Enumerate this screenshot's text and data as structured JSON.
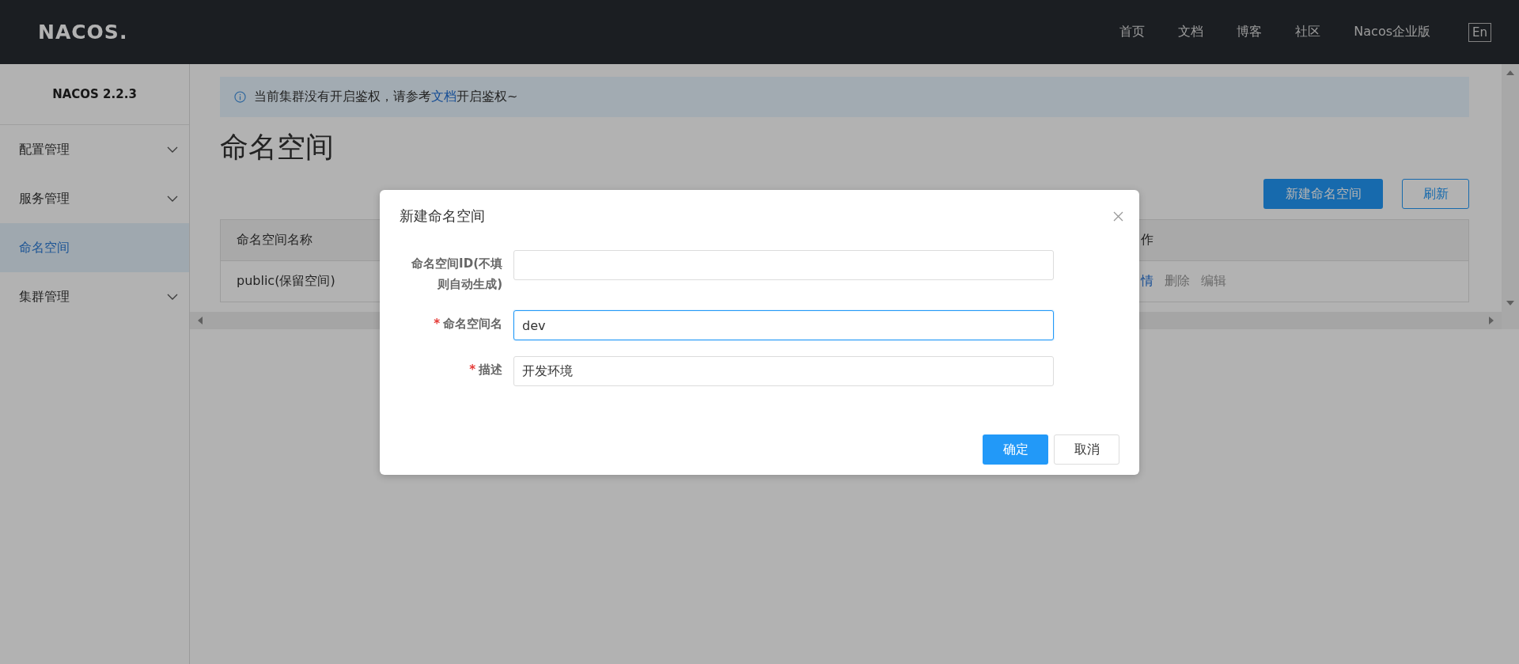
{
  "header": {
    "logo": "NACOS.",
    "nav": [
      {
        "label": "首页"
      },
      {
        "label": "文档"
      },
      {
        "label": "博客"
      },
      {
        "label": "社区"
      },
      {
        "label": "Nacos企业版"
      }
    ],
    "language": "En"
  },
  "sidebar": {
    "version": "NACOS 2.2.3",
    "items": [
      {
        "label": "配置管理",
        "selected": false,
        "expandable": true
      },
      {
        "label": "服务管理",
        "selected": false,
        "expandable": true
      },
      {
        "label": "命名空间",
        "selected": true,
        "expandable": false
      },
      {
        "label": "集群管理",
        "selected": false,
        "expandable": true
      }
    ]
  },
  "alert": {
    "text_before": "当前集群没有开启鉴权，请参考",
    "link": "文档",
    "text_after": "开启鉴权~"
  },
  "page_title": "命名空间",
  "toolbar": {
    "buttons": [
      {
        "label": "新建命名空间",
        "kind": "primary"
      },
      {
        "label": "刷新",
        "kind": "secondary"
      }
    ]
  },
  "table": {
    "columns": [
      "命名空间名称",
      "作"
    ],
    "rows": [
      {
        "name": "public(保留空间)",
        "actions": [
          {
            "label": "情",
            "kind": "link"
          },
          {
            "label": "删除",
            "kind": "muted"
          },
          {
            "label": "编辑",
            "kind": "muted"
          }
        ]
      }
    ]
  },
  "dialog": {
    "title": "新建命名空间",
    "required_mark": "*",
    "fields": [
      {
        "label": "命名空间ID(不填则自动生成)",
        "required": false,
        "focused": false
      },
      {
        "label": "命名空间名",
        "required": true,
        "focused": true,
        "value": "dev"
      },
      {
        "label": "描述",
        "required": true,
        "focused": false,
        "value": "开发环境"
      }
    ],
    "buttons": [
      {
        "label": "确定",
        "kind": "primary"
      },
      {
        "label": "取消",
        "kind": "default"
      }
    ]
  }
}
